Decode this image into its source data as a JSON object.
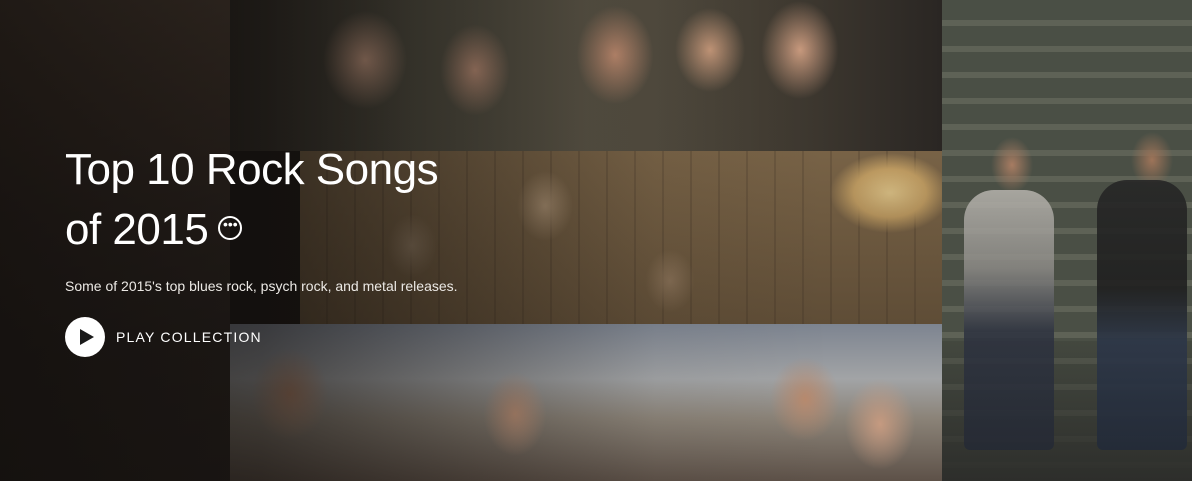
{
  "collection": {
    "title_line1": "Top 10 Rock Songs",
    "title_line2": "of 2015",
    "more_icon": "more-horizontal-icon",
    "description": "Some of 2015's top blues rock, psych rock, and metal releases.",
    "play_icon": "play-icon",
    "play_label": "PLAY COLLECTION"
  },
  "colors": {
    "text": "#ffffff",
    "play_button_bg": "#ffffff",
    "play_icon": "#1a1a1a"
  }
}
